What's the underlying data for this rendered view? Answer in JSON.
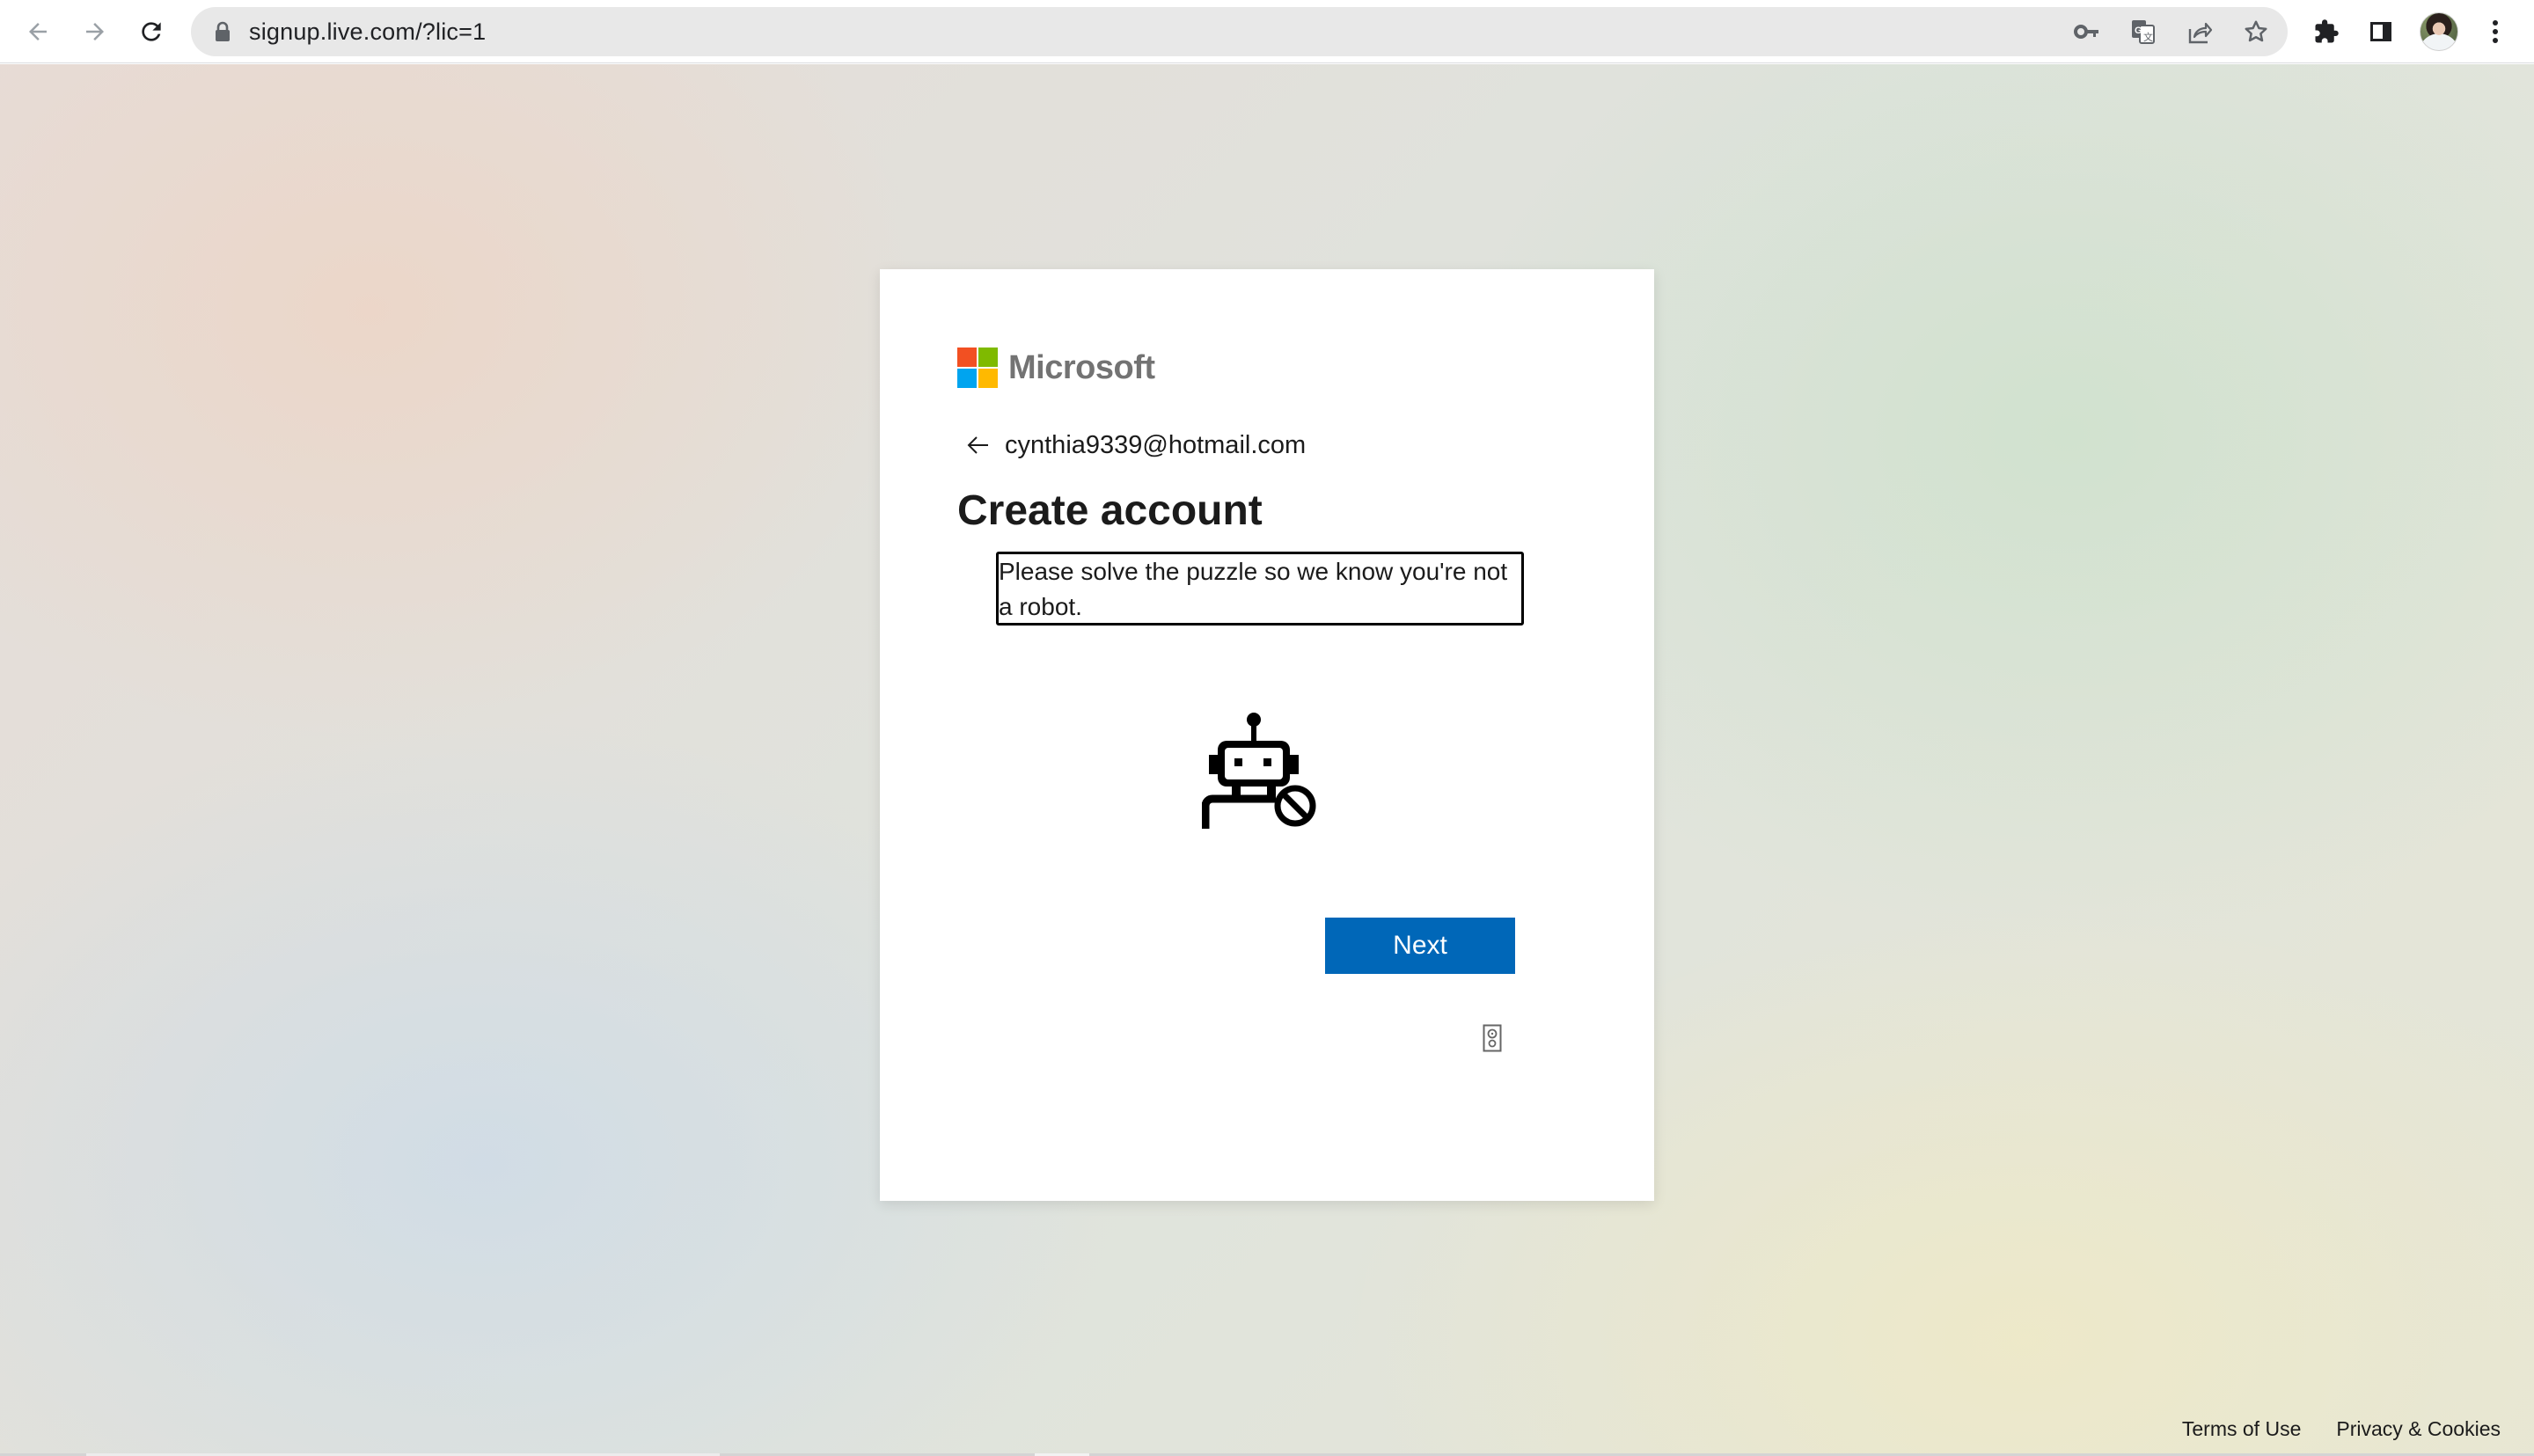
{
  "browser": {
    "url": "signup.live.com/?lic=1",
    "nav": {
      "back_icon": "arrow-left-icon",
      "forward_icon": "arrow-right-icon",
      "reload_icon": "reload-icon"
    },
    "omnibox_icons": [
      "lock-icon",
      "key-icon",
      "translate-icon",
      "share-icon",
      "star-icon"
    ],
    "toolbar_icons": [
      "extensions-puzzle-icon",
      "side-panel-icon",
      "profile-avatar",
      "kebab-menu-icon"
    ]
  },
  "card": {
    "brand": {
      "name": "Microsoft",
      "colors": [
        "#f25022",
        "#7fba00",
        "#00a4ef",
        "#ffb900"
      ]
    },
    "identity": {
      "back_icon": "arrow-left-icon",
      "email": "cynthia9339@hotmail.com"
    },
    "title": "Create account",
    "puzzle_prompt": "Please solve the puzzle so we know you're not a robot.",
    "illustration": "robot-blocked-icon",
    "next_label": "Next",
    "next_color": "#0067b8",
    "audio_icon": "speaker-icon"
  },
  "footer": {
    "links": [
      {
        "label": "Terms of Use"
      },
      {
        "label": "Privacy & Cookies"
      }
    ]
  }
}
